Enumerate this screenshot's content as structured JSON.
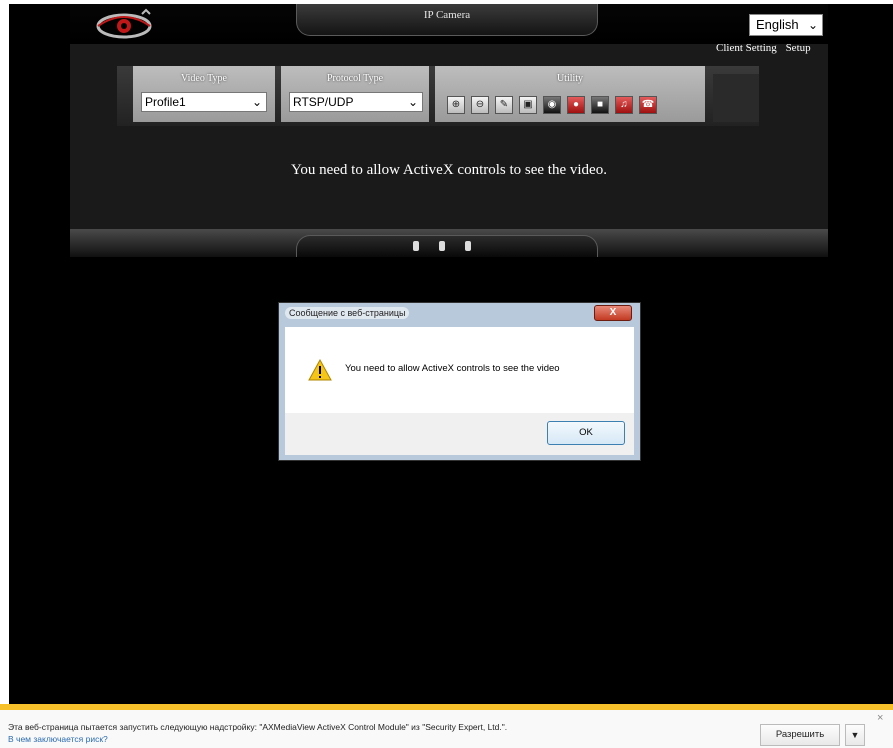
{
  "camera_page": {
    "title": "IP Camera",
    "language": "English",
    "links": {
      "client_setting": "Client Setting",
      "setup": "Setup"
    },
    "video_type": {
      "label": "Video Type",
      "value": "Profile1"
    },
    "protocol_type": {
      "label": "Protocol Type",
      "value": "RTSP/UDP"
    },
    "utility": {
      "label": "Utility",
      "buttons": [
        "zoom-in-icon",
        "zoom-out-icon",
        "edit-icon",
        "fullscreen-icon",
        "snapshot-icon",
        "record-icon",
        "stop-icon",
        "audio-icon",
        "talk-icon"
      ]
    },
    "activex_message": "You need to allow ActiveX controls to see the video."
  },
  "dialog": {
    "title": "Сообщение с веб-страницы",
    "close": "X",
    "message": "You need to allow ActiveX controls to see the video",
    "ok": "OK"
  },
  "notification": {
    "text": "Эта веб-страница пытается запустить следующую надстройку: \"AXMediaView ActiveX Control Module\" из \"Security Expert, Ltd.\".",
    "link": "В чем заключается риск?",
    "allow": "Разрешить",
    "dropdown": "▼",
    "close": "×"
  },
  "colors": {
    "notification_accent": "#f6c12a",
    "dialog_close": "#c23a22",
    "page_bg": "#000000"
  }
}
